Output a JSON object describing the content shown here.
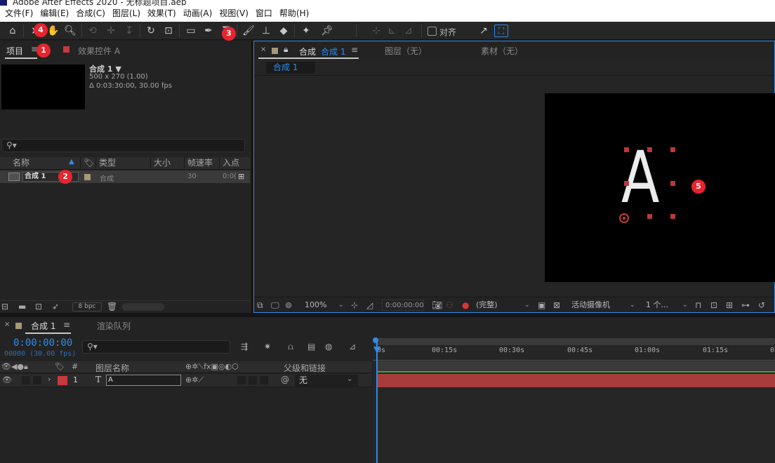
{
  "window": {
    "title": "Adobe After Effects 2020 - 无标题项目.aep"
  },
  "menu": [
    "文件(F)",
    "编辑(E)",
    "合成(C)",
    "图层(L)",
    "效果(T)",
    "动画(A)",
    "视图(V)",
    "窗口",
    "帮助(H)"
  ],
  "toolbar": {
    "align_label": "对齐"
  },
  "badges": [
    "1",
    "2",
    "3",
    "4",
    "5"
  ],
  "project_panel": {
    "tab_label": "项目",
    "effects_tab": "效果控件 A",
    "comp_name": "合成 1 ▼",
    "comp_size": "500 x 270 (1.00)",
    "comp_duration": "Δ 0:03:30:00, 30.00 fps",
    "search_icon": "search-icon",
    "columns": [
      "名称",
      "类型",
      "大小",
      "帧速率",
      "入点"
    ],
    "items": [
      {
        "name": "合成 1",
        "type": "合成",
        "fps": "30",
        "in": "0:0("
      }
    ],
    "bpc": "8 bpc"
  },
  "comp_panel": {
    "lock_icon": "lock-icon",
    "tab_prefix": "合成",
    "tab_name": "合成 1",
    "layer_tab": "图层（无）",
    "footage_tab": "素材（无）",
    "sub_tab": "合成 1",
    "canvas_text": "A",
    "zoom": "100%",
    "timecode": "0:00:00:00",
    "resolution": "(完整)",
    "camera": "活动摄像机",
    "views": "1 个..."
  },
  "timeline": {
    "tab": "合成 1",
    "render_queue": "渲染队列",
    "timecode": "0:00:00:00",
    "frames": "00000 (30.00 fps)",
    "col_num": "#",
    "col_layer_name": "图层名称",
    "col_parent": "父级和链接",
    "layer": {
      "index": "1",
      "type_icon": "T",
      "name": "A",
      "parent": "无"
    },
    "ruler": [
      "0s",
      "00:15s",
      "00:30s",
      "00:45s",
      "01:00s",
      "01:15s",
      "0"
    ]
  },
  "colors": {
    "accent": "#2d8ceb",
    "label_red": "#c8393d",
    "layer_bar": "#a83c3c",
    "badge": "#e8242f"
  }
}
